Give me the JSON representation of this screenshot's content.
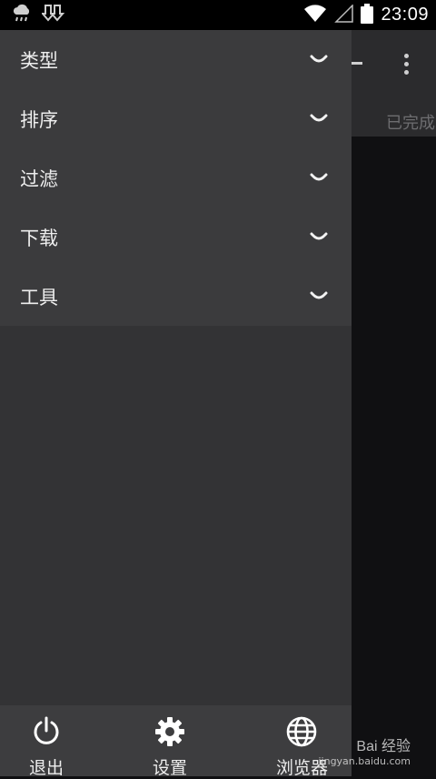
{
  "status_bar": {
    "time": "23:09",
    "icons": [
      "weather-cloud-icon",
      "download-icon",
      "wifi-icon",
      "signal-icon",
      "battery-icon"
    ]
  },
  "background_app": {
    "tab_completed": "已完成"
  },
  "drawer": {
    "menu_items": [
      {
        "label": "类型"
      },
      {
        "label": "排序"
      },
      {
        "label": "过滤"
      },
      {
        "label": "下载"
      },
      {
        "label": "工具"
      }
    ],
    "bottom": {
      "exit_label": "退出",
      "settings_label": "设置",
      "browser_label": "浏览器"
    }
  },
  "watermark": {
    "brand": "Bai 经验",
    "url": "jingyan.baidu.com"
  },
  "colors": {
    "drawer_bg": "#333335",
    "menu_bg": "#3b3b3d",
    "bottom_bar_bg": "#3d3d3f",
    "status_bar_bg": "#000000"
  }
}
